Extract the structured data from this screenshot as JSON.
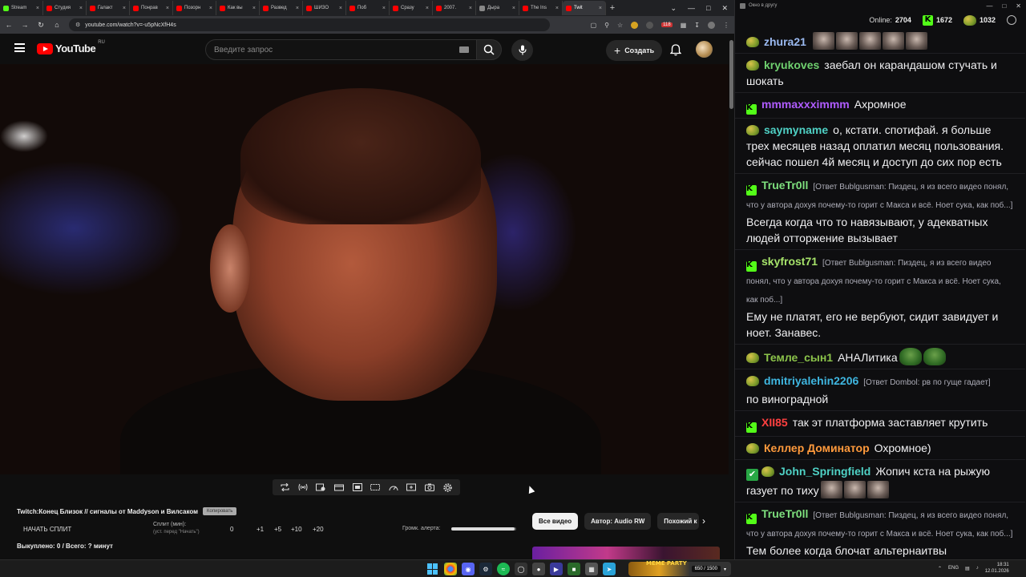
{
  "browser": {
    "tabs": [
      {
        "label": "Stream",
        "color": "#53fc18"
      },
      {
        "label": "Студия",
        "color": "#ff0000"
      },
      {
        "label": "Галакт",
        "color": "#ff0000"
      },
      {
        "label": "Понрав",
        "color": "#ff0000"
      },
      {
        "label": "Позорн",
        "color": "#ff0000"
      },
      {
        "label": "Как вы",
        "color": "#ff0000"
      },
      {
        "label": "Развед",
        "color": "#ff0000"
      },
      {
        "label": "ШИЗО",
        "color": "#ff0000"
      },
      {
        "label": "Поб",
        "color": "#ff0000"
      },
      {
        "label": "Сразу",
        "color": "#ff0000"
      },
      {
        "label": "2007.",
        "color": "#ff0000"
      },
      {
        "label": "Дыра",
        "color": "#888888"
      },
      {
        "label": "The Ins",
        "color": "#ff0000"
      },
      {
        "label": "Twit",
        "color": "#ff0000"
      }
    ],
    "url": "youtube.com/watch?v=-u5pNcXfH4s",
    "badge_count": "118"
  },
  "youtube": {
    "logo_text": "YouTube",
    "country": "RU",
    "search_placeholder": "Введите запрос",
    "create_label": "Создать"
  },
  "player": {
    "stream_title": "Twitch:Конец Близок // сигналы от Maddyson и Вилсаком",
    "copy_label": "Копировать",
    "start_split": "НАЧАТЬ СПЛИТ",
    "split_label": "Сплит (мин):",
    "split_sub": "(уст. перед \"Начать\")",
    "split_value": "0",
    "increments": [
      "+1",
      "+5",
      "+10",
      "+20"
    ],
    "volume_label": "Громк. алерта:",
    "volume_level": 0.98,
    "bought": "Выкуплено: 0 / Всего: ? минут"
  },
  "chips": [
    "Все видео",
    "Автор: Audio RW",
    "Похожий к"
  ],
  "chat": {
    "window_title": "Окно в другу",
    "online_label": "Online:",
    "online_count": "2704",
    "kick_count": "1672",
    "pepe_count": "1032",
    "messages": [
      {
        "badge": "pepe",
        "user": "zhura21",
        "color": "#9ab9f0",
        "reply": "",
        "text": "",
        "emotes": 5
      },
      {
        "badge": "pepe",
        "user": "kryukoves",
        "color": "#6fd06f",
        "reply": "",
        "text": "заебал он карандашом стучать и шокать",
        "emotes": 0
      },
      {
        "badge": "kick",
        "user": "mmmaxxximmm",
        "color": "#b05cff",
        "reply": "",
        "text": "Ахромное",
        "emotes": 0
      },
      {
        "badge": "pepe",
        "user": "saymyname",
        "color": "#4fd1c5",
        "reply": "",
        "text": "о, кстати. спотифай. я больше трех месяцев назад оплатил месяц пользования. сейчас пошел 4й месяц и доступ до сих пор есть",
        "emotes": 0
      },
      {
        "badge": "kick",
        "user": "TrueTr0ll",
        "color": "#7ee07e",
        "reply": "[Ответ Bublgusman: Пиздец, я из всего видео понял, что у автора дохуя почему-то горит с Макса и всё. Ноет сука, как поб...]",
        "text": "Всегда когда что то навязывают, у адекватных людей отторжение вызывает",
        "emotes": 0
      },
      {
        "badge": "kick",
        "user": "skyfrost71",
        "color": "#a6e36a",
        "reply": "[Ответ Bublgusman: Пиздец, я из всего видео понял, что у автора дохуя почему-то горит с Макса и всё. Ноет сука, как поб...]",
        "text": "Ему не платят, его не вербуют, сидит завидует и ноет. Занавес.",
        "emotes": 0
      },
      {
        "badge": "pepe",
        "user": "Темле_сын1",
        "color": "#8bc34a",
        "reply": "",
        "text": "АНАЛитика",
        "emotes": 0,
        "frogs": 2
      },
      {
        "badge": "pepe",
        "user": "dmitriyalehin2206",
        "color": "#3fb6e0",
        "reply": "[Ответ Dombol: рв по гуще гадает]",
        "text": "по виноградной",
        "emotes": 0
      },
      {
        "badge": "kick",
        "user": "XII85",
        "color": "#ff4040",
        "reply": "",
        "text": "так эт платформа заставляет крутить",
        "emotes": 0
      },
      {
        "badge": "pepe",
        "user": "Келлер Доминатор",
        "color": "#ff9a3c",
        "reply": "",
        "text": "Охромное)",
        "emotes": 0
      },
      {
        "badge": "check-pepe",
        "user": "John_Springfield",
        "color": "#4fd1c5",
        "reply": "",
        "text": "Жопич кста на рыжую газует по тиху",
        "emotes": 3
      },
      {
        "badge": "kick",
        "user": "TrueTr0ll",
        "color": "#7ee07e",
        "reply": "[Ответ Bublgusman: Пиздец, я из всего видео понял, что у автора дохуя почему-то горит с Макса и всё. Ноет сука, как поб...]",
        "text": "Тем более когда блочат альтернаитвы",
        "emotes": 0
      }
    ]
  },
  "taskbar": {
    "party_title": "MEME PARTY",
    "party_count": "650 / 1500",
    "lang": "ENG",
    "time": "18:31",
    "date": "12.01.2026"
  }
}
